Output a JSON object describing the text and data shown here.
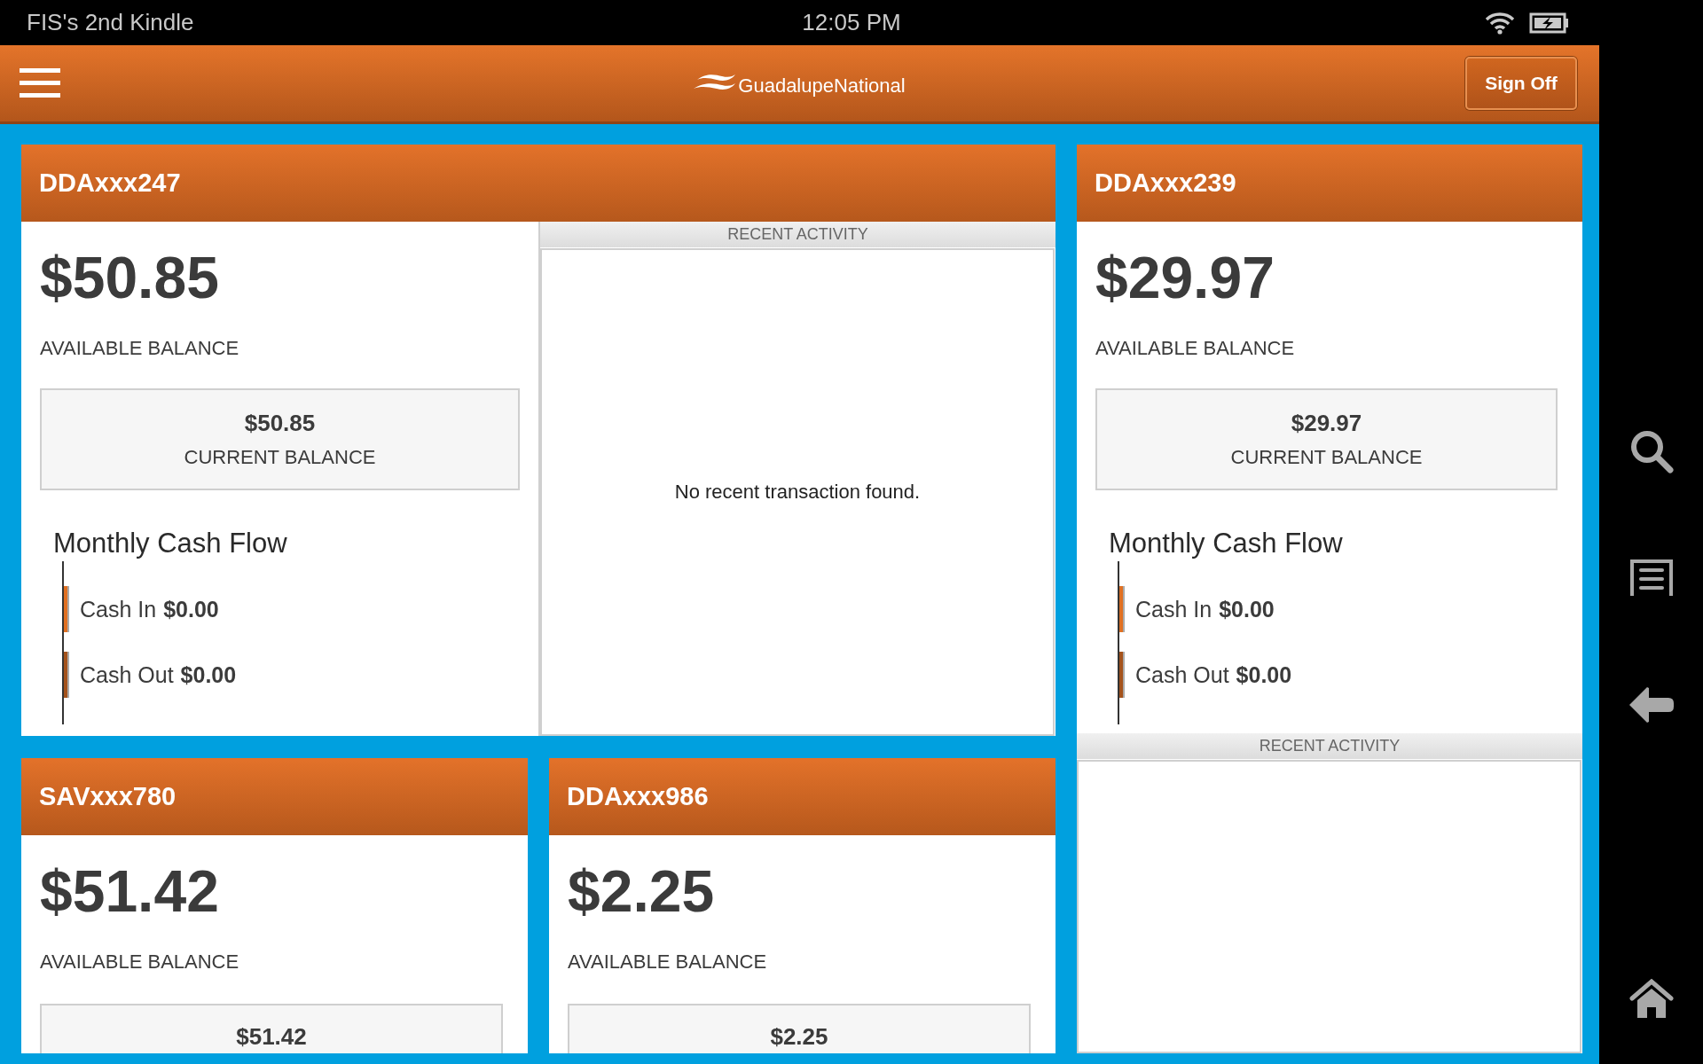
{
  "status_bar": {
    "device_name": "FIS's 2nd Kindle",
    "time": "12:05 PM"
  },
  "header": {
    "logo_text": "GuadalupeNational",
    "sign_off": "Sign Off"
  },
  "accounts": [
    {
      "name": "DDAxxx247",
      "kind": "wide",
      "available_balance": "$50.85",
      "available_label": "AVAILABLE BALANCE",
      "current_balance": "$50.85",
      "current_label": "CURRENT BALANCE",
      "cash_flow": {
        "title": "Monthly Cash Flow",
        "items": [
          {
            "label": "Cash In",
            "amount": "$0.00",
            "color": "#e07022"
          },
          {
            "label": "Cash Out",
            "amount": "$0.00",
            "color": "#a4531c"
          }
        ]
      },
      "recent_activity": {
        "title": "RECENT ACTIVITY",
        "message": "No recent transaction found."
      }
    },
    {
      "name": "DDAxxx239",
      "kind": "tall",
      "available_balance": "$29.97",
      "available_label": "AVAILABLE BALANCE",
      "current_balance": "$29.97",
      "current_label": "CURRENT BALANCE",
      "cash_flow": {
        "title": "Monthly Cash Flow",
        "items": [
          {
            "label": "Cash In",
            "amount": "$0.00",
            "color": "#e07022"
          },
          {
            "label": "Cash Out",
            "amount": "$0.00",
            "color": "#a4531c"
          }
        ]
      },
      "recent_activity": {
        "title": "RECENT ACTIVITY"
      }
    },
    {
      "name": "SAVxxx780",
      "kind": "small",
      "available_balance": "$51.42",
      "available_label": "AVAILABLE BALANCE",
      "current_balance": "$51.42"
    },
    {
      "name": "DDAxxx986",
      "kind": "small",
      "available_balance": "$2.25",
      "available_label": "AVAILABLE BALANCE",
      "current_balance": "$2.25"
    }
  ]
}
